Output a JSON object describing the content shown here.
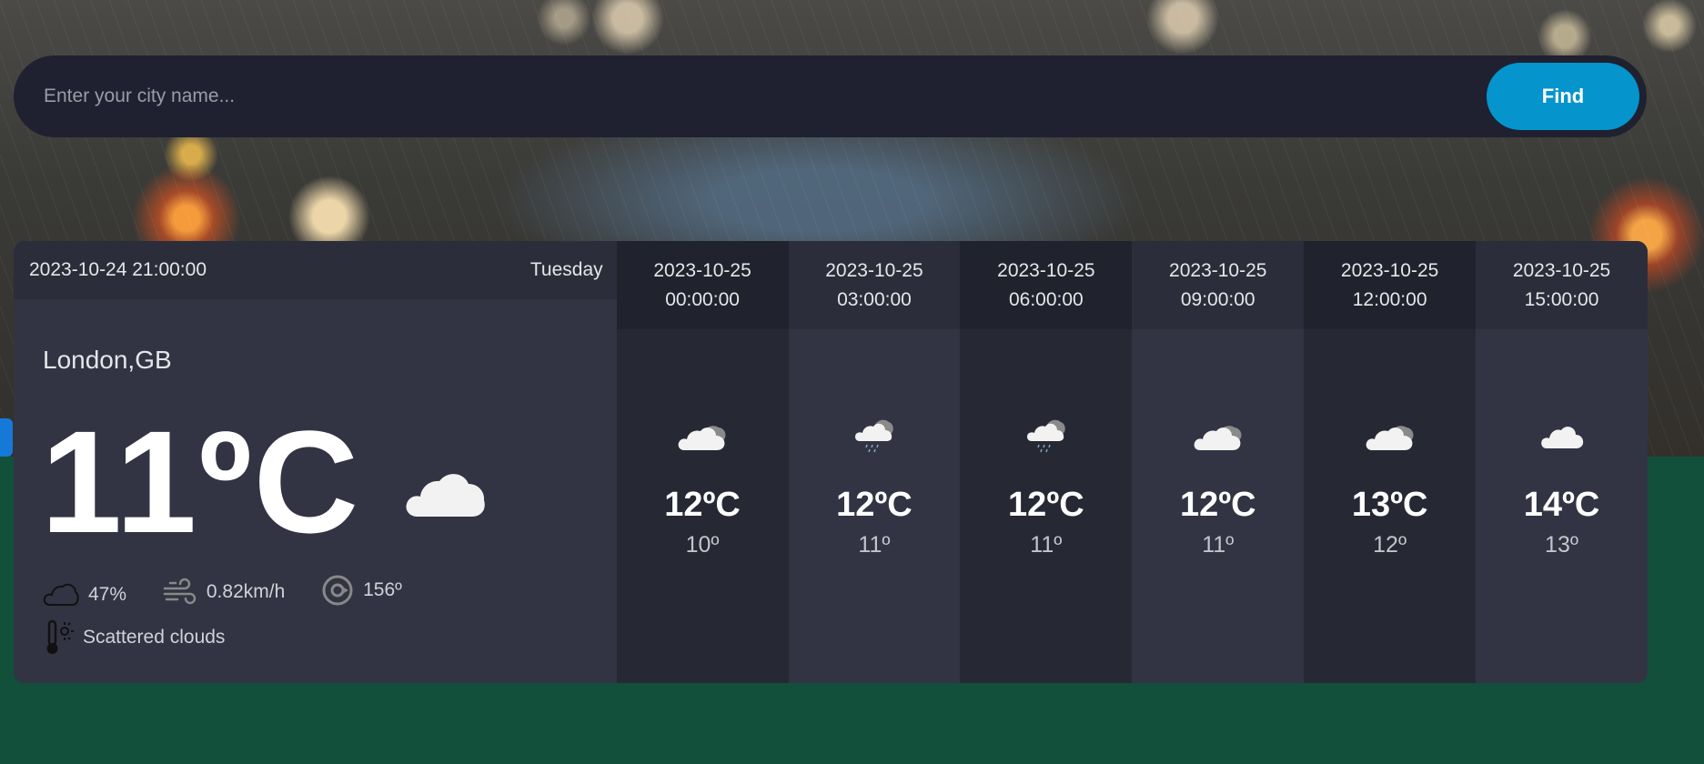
{
  "search": {
    "placeholder": "Enter your city name...",
    "button_label": "Find"
  },
  "current": {
    "datetime": "2023-10-24 21:00:00",
    "day": "Tuesday",
    "city": "London,GB",
    "temperature": "11ºC",
    "icon": "cloud-icon",
    "clouds": "47%",
    "wind": "0.82km/h",
    "direction": "156º",
    "description": "Scattered clouds"
  },
  "forecast": [
    {
      "date": "2023-10-25",
      "time": "00:00:00",
      "temp": "12ºC",
      "min": "10º",
      "icon": "cloud-sun-icon"
    },
    {
      "date": "2023-10-25",
      "time": "03:00:00",
      "temp": "12ºC",
      "min": "11º",
      "icon": "light-rain-icon"
    },
    {
      "date": "2023-10-25",
      "time": "06:00:00",
      "temp": "12ºC",
      "min": "11º",
      "icon": "light-rain-icon"
    },
    {
      "date": "2023-10-25",
      "time": "09:00:00",
      "temp": "12ºC",
      "min": "11º",
      "icon": "cloud-sun-icon"
    },
    {
      "date": "2023-10-25",
      "time": "12:00:00",
      "temp": "13ºC",
      "min": "12º",
      "icon": "cloud-sun-icon"
    },
    {
      "date": "2023-10-25",
      "time": "15:00:00",
      "temp": "14ºC",
      "min": "13º",
      "icon": "cloud-icon"
    }
  ],
  "colors": {
    "search_bg": "#1f2130",
    "find_button": "#0594cc",
    "card_bg": "#323443",
    "card_dark_column": "#262834",
    "page_green": "#12503b"
  }
}
